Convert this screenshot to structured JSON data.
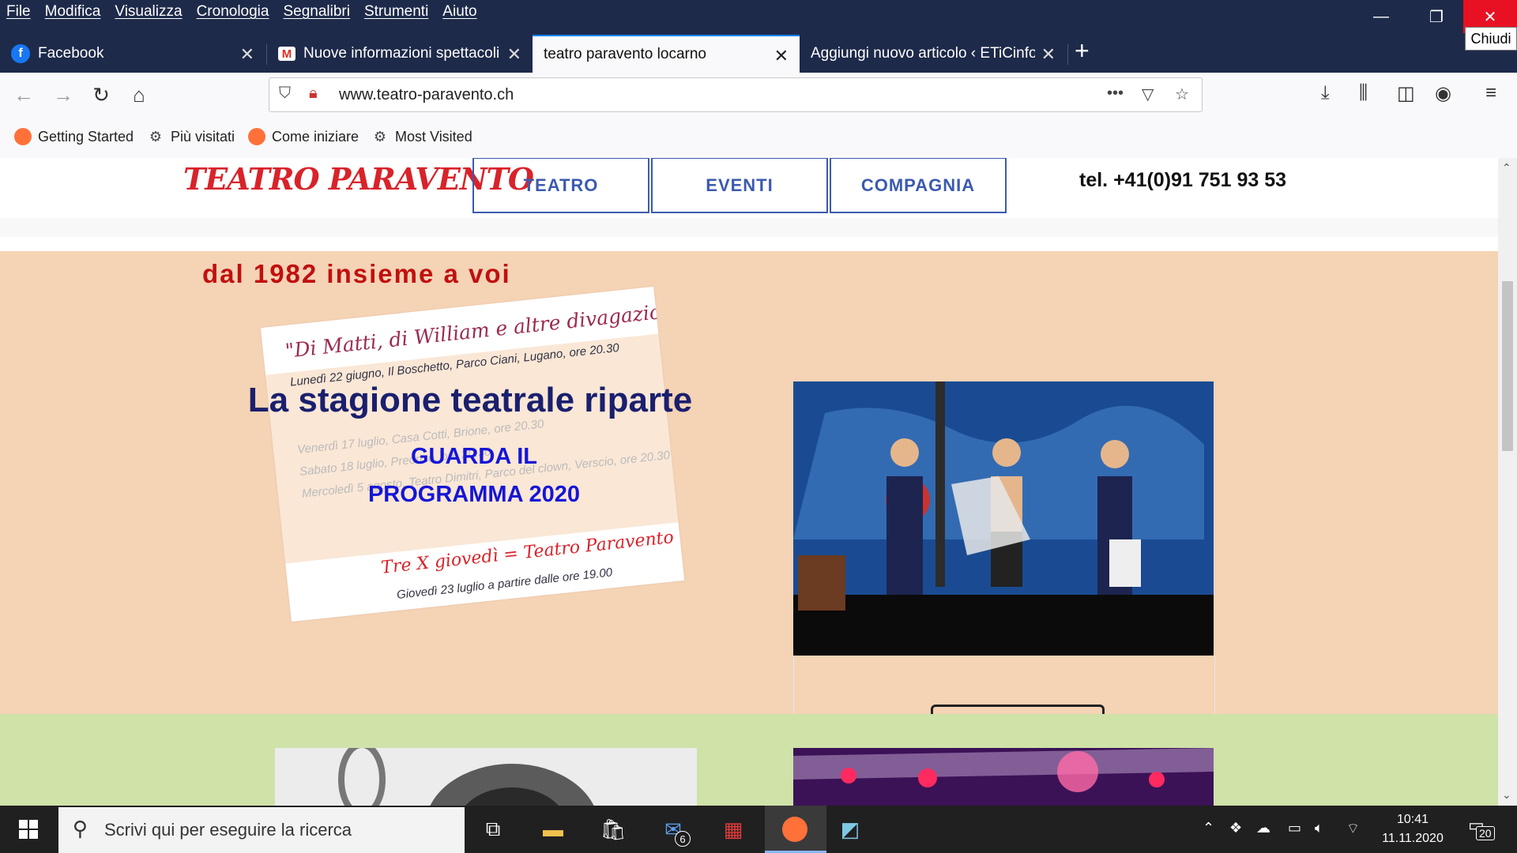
{
  "menu": {
    "items": [
      "File",
      "Modifica",
      "Visualizza",
      "Cronologia",
      "Segnalibri",
      "Strumenti",
      "Aiuto"
    ]
  },
  "window": {
    "close_tooltip": "Chiudi"
  },
  "tabs": [
    {
      "label": "Facebook",
      "icon": "facebook-icon",
      "active": false
    },
    {
      "label": "Nuove informazioni spettacoli -",
      "icon": "gmail-icon",
      "active": false
    },
    {
      "label": "teatro paravento locarno",
      "icon": "",
      "active": true
    },
    {
      "label": "Aggiungi nuovo articolo ‹ ETiCinfor",
      "icon": "",
      "active": false
    }
  ],
  "address": {
    "url": "www.teatro-paravento.ch"
  },
  "bookmarks": [
    {
      "label": "Getting Started",
      "icon": "firefox-icon"
    },
    {
      "label": "Più visitati",
      "icon": "gear-icon"
    },
    {
      "label": "Come iniziare",
      "icon": "firefox-icon"
    },
    {
      "label": "Most Visited",
      "icon": "gear-icon"
    }
  ],
  "site": {
    "logo": "Teatro Paravento",
    "nav": [
      "TEATRO",
      "EVENTI",
      "COMPAGNIA"
    ],
    "phone": "tel. +41(0)91 751 93 53",
    "tagline": "dal 1982 insieme a voi",
    "headline": "La stagione teatrale riparte",
    "cta_line1": "GUARDA IL",
    "cta_line2": "PROGRAMMA 2020",
    "company_button": "COMPAGNIA",
    "poster": {
      "title": "\"Di Matti, di William e altre divagazioni\"",
      "lines": [
        "Lunedì 22 giugno, Il Boschetto, Parco Ciani, Lugano, ore 20.30",
        "Venerdì 17 luglio, Casa Cotti, Brione, ore 20.30",
        "Sabato 18 luglio, Preonzo, ore 20.30",
        "Mercoledì 5 agosto, Teatro Dimitri, Parco del clown, Verscio, ore 20.30"
      ],
      "footer": "Tre X giovedì = Teatro Paravento",
      "footer_date": "Giovedì 23 luglio a partire dalle ore 19.00"
    }
  },
  "taskbar": {
    "search_placeholder": "Scrivi qui per eseguire la ricerca",
    "mail_badge": "6",
    "time": "10:41",
    "date": "11.11.2020",
    "notifications": "20"
  },
  "colors": {
    "accent": "#0a84ff",
    "brand_red": "#d8232a",
    "nav_blue": "#3b5ab0",
    "peach": "#f5d3b5",
    "green": "#cfe2a8"
  }
}
